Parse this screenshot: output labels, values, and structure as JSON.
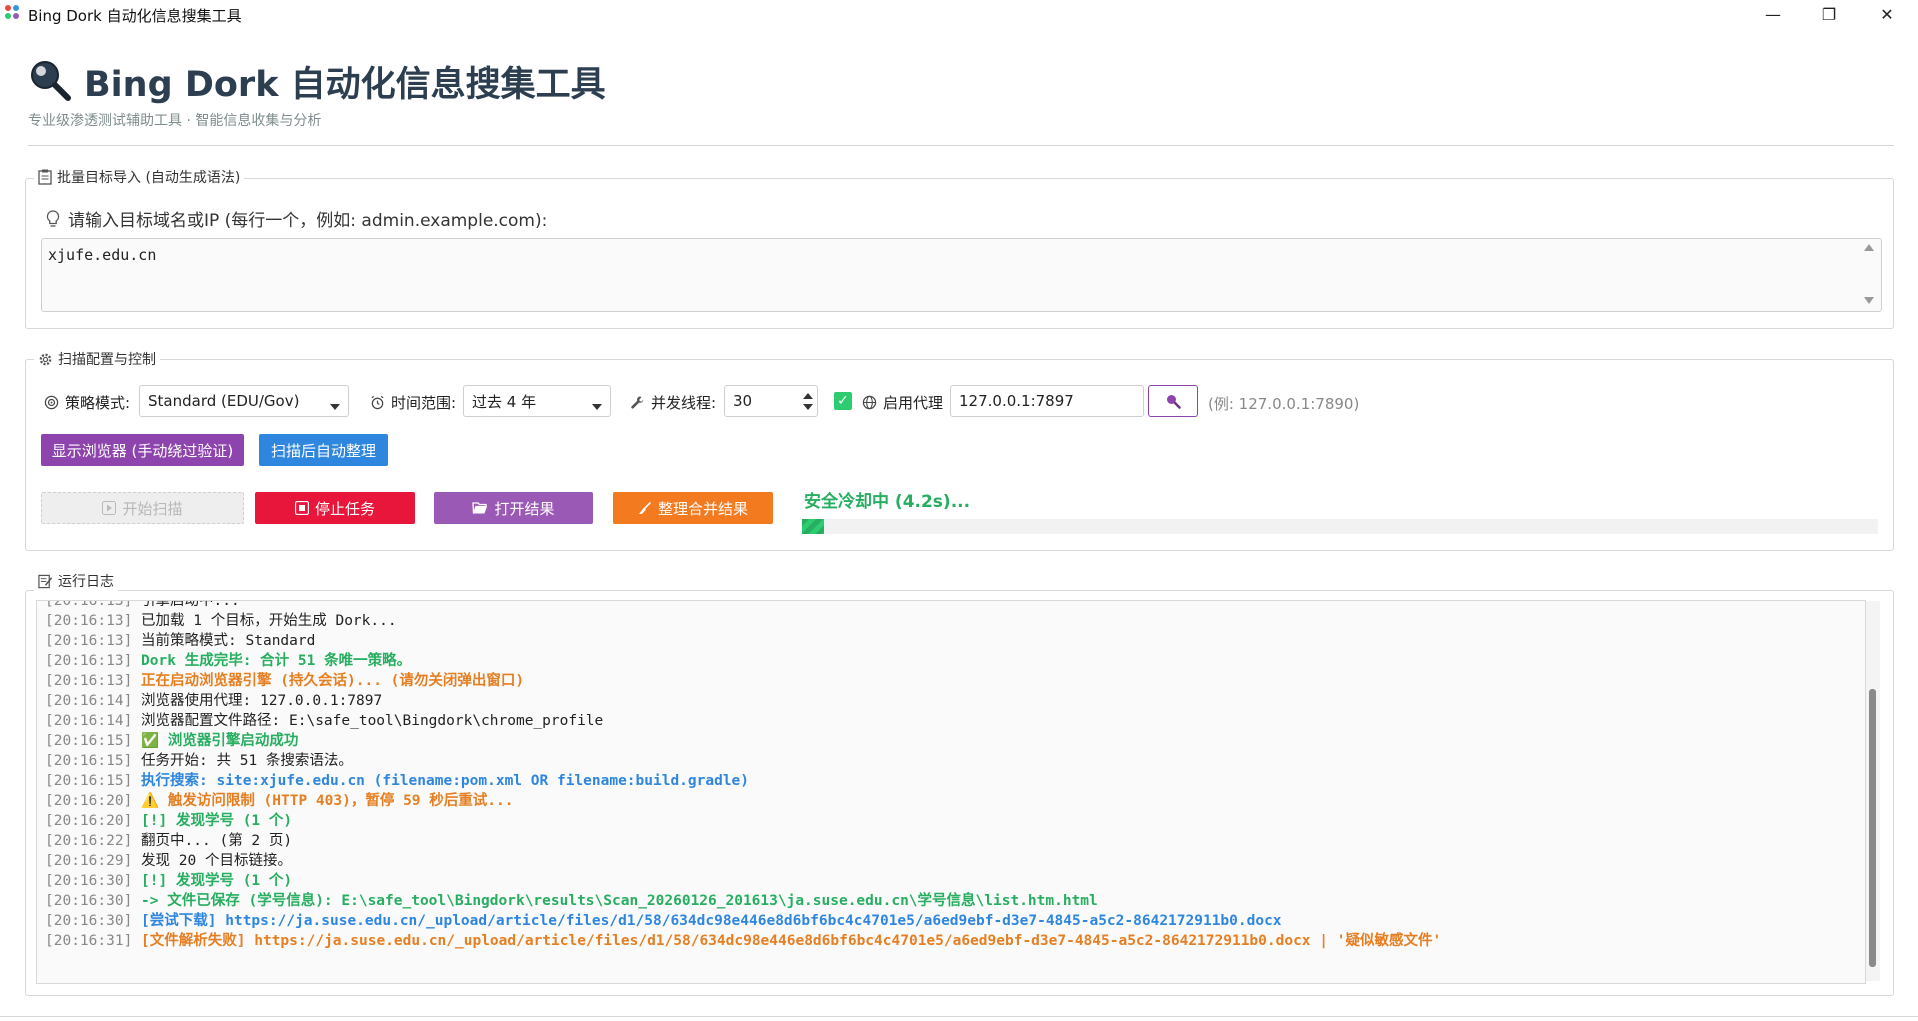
{
  "window": {
    "title": "Bing Dork 自动化信息搜集工具",
    "controls": [
      "—",
      "❐",
      "✕"
    ]
  },
  "header": {
    "icon": "magnifier-icon",
    "title": "Bing Dork 自动化信息搜集工具",
    "subtitle": "专业级渗透测试辅助工具 · 智能信息收集与分析"
  },
  "targets": {
    "group_title": "批量目标导入 (自动生成语法)",
    "group_icon": "clipboard-icon",
    "hint": "请输入目标域名或IP (每行一个，例如: admin.example.com):",
    "hint_icon": "lightbulb-icon",
    "value": "xjufe.edu.cn"
  },
  "config": {
    "group_title": "扫描配置与控制",
    "group_icon": "gear-icon",
    "strategy_label": "策略模式:",
    "strategy_icon": "target-icon",
    "strategy_value": "Standard (EDU/Gov)",
    "time_label": "时间范围:",
    "time_icon": "alarm-clock-icon",
    "time_value": "过去 4 年",
    "threads_label": "并发线程:",
    "threads_icon": "wrench-icon",
    "threads_value": "30",
    "proxy_checkbox": "✓",
    "proxy_label": "启用代理",
    "proxy_icon": "globe-icon",
    "proxy_value": "127.0.0.1:7897",
    "proxy_test_icon": "magnifier-icon",
    "proxy_example": "(例: 127.0.0.1:7890)",
    "show_browser_label": "显示浏览器 (手动绕过验证)",
    "auto_organize_label": "扫描后自动整理",
    "start_label": "开始扫描",
    "stop_label": "停止任务",
    "open_results_label": "打开结果",
    "merge_label": "整理合并结果",
    "colors": {
      "purple": "#8e44ad",
      "blue": "#2e86de",
      "red": "#e8163a",
      "violet": "#9b59b6",
      "orange": "#f47a1f",
      "green": "#27ae60"
    }
  },
  "status": {
    "text": "安全冷却中 (4.2s)...",
    "progress": 0.02
  },
  "log": {
    "group_title": "运行日志",
    "group_icon": "memo-icon",
    "lines": [
      {
        "ts": "[20:16:13]",
        "text": "引擎启动中...",
        "color": "#222222",
        "bold": false
      },
      {
        "ts": "[20:16:13]",
        "text": "已加载 1 个目标，开始生成 Dork...",
        "color": "#222222",
        "bold": false
      },
      {
        "ts": "[20:16:13]",
        "text": "当前策略模式: Standard",
        "color": "#222222",
        "bold": false
      },
      {
        "ts": "[20:16:13]",
        "text": "Dork 生成完毕: 合计 51 条唯一策略。",
        "color": "#27ae60",
        "bold": true
      },
      {
        "ts": "[20:16:13]",
        "text": "正在启动浏览器引擎 (持久会话)... (请勿关闭弹出窗口)",
        "color": "#e67e22",
        "bold": true
      },
      {
        "ts": "[20:16:14]",
        "text": "浏览器使用代理: 127.0.0.1:7897",
        "color": "#222222",
        "bold": false
      },
      {
        "ts": "[20:16:14]",
        "text": "浏览器配置文件路径: E:\\safe_tool\\Bingdork\\chrome_profile",
        "color": "#222222",
        "bold": false
      },
      {
        "ts": "[20:16:15]",
        "text": "✅ 浏览器引擎启动成功",
        "color": "#27ae60",
        "bold": true
      },
      {
        "ts": "[20:16:15]",
        "text": "任务开始: 共 51 条搜索语法。",
        "color": "#222222",
        "bold": false
      },
      {
        "ts": "[20:16:15]",
        "text": "执行搜索: site:xjufe.edu.cn (filename:pom.xml OR filename:build.gradle)",
        "color": "#2e86de",
        "bold": true
      },
      {
        "ts": "[20:16:20]",
        "text": "⚠️ 触发访问限制 (HTTP 403)，暂停 59 秒后重试...",
        "color": "#e67e22",
        "bold": true
      },
      {
        "ts": "[20:16:20]",
        "text": "   [!] 发现学号 (1 个)",
        "color": "#27ae60",
        "bold": true
      },
      {
        "ts": "[20:16:22]",
        "text": "翻页中... (第 2 页)",
        "color": "#222222",
        "bold": false
      },
      {
        "ts": "[20:16:29]",
        "text": "发现 20 个目标链接。",
        "color": "#222222",
        "bold": false
      },
      {
        "ts": "[20:16:30]",
        "text": "   [!] 发现学号 (1 个)",
        "color": "#27ae60",
        "bold": true
      },
      {
        "ts": "[20:16:30]",
        "text": "      -> 文件已保存 (学号信息): E:\\safe_tool\\Bingdork\\results\\Scan_20260126_201613\\ja.suse.edu.cn\\学号信息\\list.htm.html",
        "color": "#27ae60",
        "bold": true
      },
      {
        "ts": "[20:16:30]",
        "text": "[尝试下载] https://ja.suse.edu.cn/_upload/article/files/d1/58/634dc98e446e8d6bf6bc4c4701e5/a6ed9ebf-d3e7-4845-a5c2-8642172911b0.docx",
        "color": "#2e86de",
        "bold": true
      },
      {
        "ts": "[20:16:31]",
        "text": "[文件解析失败] https://ja.suse.edu.cn/_upload/article/files/d1/58/634dc98e446e8d6bf6bc4c4701e5/a6ed9ebf-d3e7-4845-a5c2-8642172911b0.docx | '疑似敏感文件'",
        "color": "#e67e22",
        "bold": true
      }
    ]
  }
}
